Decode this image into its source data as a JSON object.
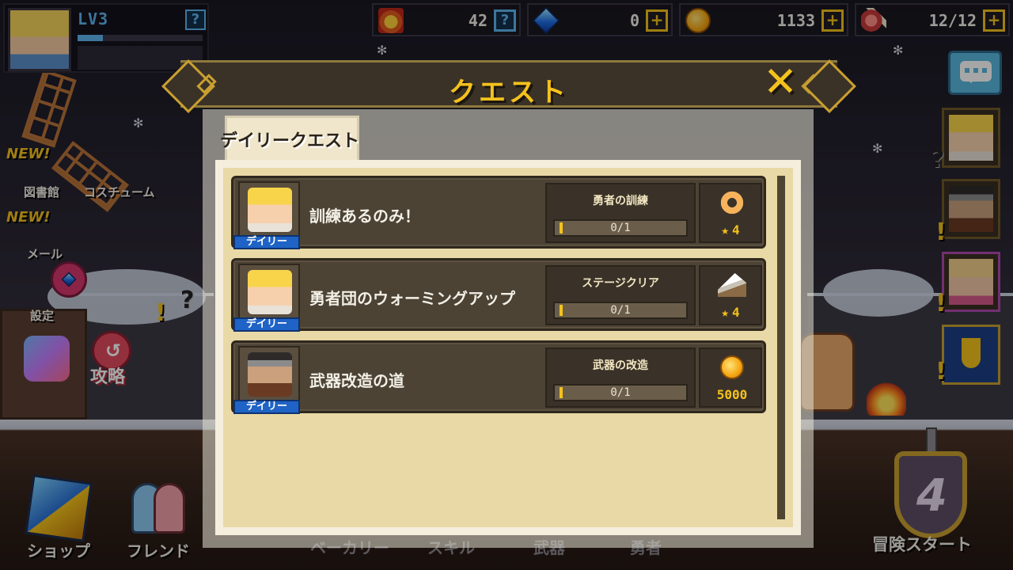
{
  "hud": {
    "level": "LV3",
    "help": "?",
    "resources": [
      {
        "name": "medal",
        "value": "42",
        "button": "?"
      },
      {
        "name": "gem",
        "value": "0",
        "button": "+"
      },
      {
        "name": "gold",
        "value": "1133",
        "button": "+"
      },
      {
        "name": "stamina",
        "value": "12/12",
        "button": "+"
      }
    ]
  },
  "left_menu": {
    "new_badge": "NEW!",
    "library": "図書館",
    "costume": "コスチューム",
    "mail": "メール",
    "settings": "設定",
    "strategy": "攻略"
  },
  "bottom_menu": {
    "shop": "ショップ",
    "friend": "フレンド",
    "bakery": "ベーカリー",
    "skill": "スキル",
    "weapon": "武器",
    "hero": "勇者",
    "adventure_start": "冒険スタート",
    "adventure_emblem": "4"
  },
  "modal": {
    "title": "クエスト",
    "close": "✕",
    "tab": "デイリークエスト",
    "quests": [
      {
        "title": "訓練あるのみ！",
        "badge": "デイリー",
        "goal": "勇者の訓練",
        "progress": "0/1",
        "progress_value": 0,
        "reward_icon": "donut-icon",
        "reward_star": "★",
        "reward": "4"
      },
      {
        "title": "勇者団のウォーミングアップ",
        "badge": "デイリー",
        "goal": "ステージクリア",
        "progress": "0/1",
        "progress_value": 0,
        "reward_icon": "cake-icon",
        "reward_star": "★",
        "reward": "4"
      },
      {
        "title": "武器改造の道",
        "badge": "デイリー",
        "goal": "武器の改造",
        "progress": "0/1",
        "progress_value": 0,
        "reward_icon": "coin-icon",
        "reward_star": "",
        "reward": "5000"
      }
    ]
  },
  "colors": {
    "accent": "#f4c21d",
    "badge": "#1f63c6",
    "panel": "#4c4335"
  }
}
